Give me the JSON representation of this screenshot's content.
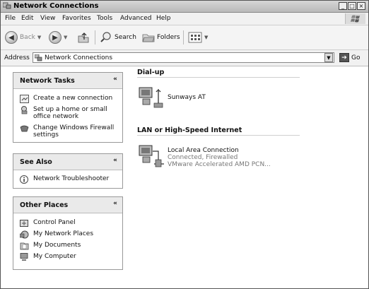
{
  "window": {
    "title": "Network Connections",
    "controls": [
      "_",
      "□",
      "×"
    ]
  },
  "menu": [
    "File",
    "Edit",
    "View",
    "Favorites",
    "Tools",
    "Advanced",
    "Help"
  ],
  "toolbar": {
    "back_label": "Back",
    "search_label": "Search",
    "folders_label": "Folders"
  },
  "address": {
    "label": "Address",
    "value": "Network Connections",
    "go_label": "Go"
  },
  "left": {
    "network_tasks": {
      "title": "Network Tasks",
      "items": [
        {
          "label": "Create a new connection",
          "icon": "new-connection-icon"
        },
        {
          "label": "Set up a home or small office network",
          "icon": "home-network-icon"
        },
        {
          "label": "Change Windows Firewall settings",
          "icon": "firewall-icon"
        }
      ]
    },
    "see_also": {
      "title": "See Also",
      "items": [
        {
          "label": "Network Troubleshooter",
          "icon": "info-icon"
        }
      ]
    },
    "other_places": {
      "title": "Other Places",
      "items": [
        {
          "label": "Control Panel",
          "icon": "control-panel-icon"
        },
        {
          "label": "My Network Places",
          "icon": "network-places-icon"
        },
        {
          "label": "My Documents",
          "icon": "documents-icon"
        },
        {
          "label": "My Computer",
          "icon": "computer-icon"
        }
      ]
    }
  },
  "content": {
    "dialup": {
      "heading": "Dial-up",
      "items": [
        {
          "name": "Sunways AT"
        }
      ]
    },
    "lan": {
      "heading": "LAN or High-Speed Internet",
      "items": [
        {
          "name": "Local Area Connection",
          "status": "Connected, Firewalled",
          "device": "VMware Accelerated AMD PCN..."
        }
      ]
    }
  }
}
